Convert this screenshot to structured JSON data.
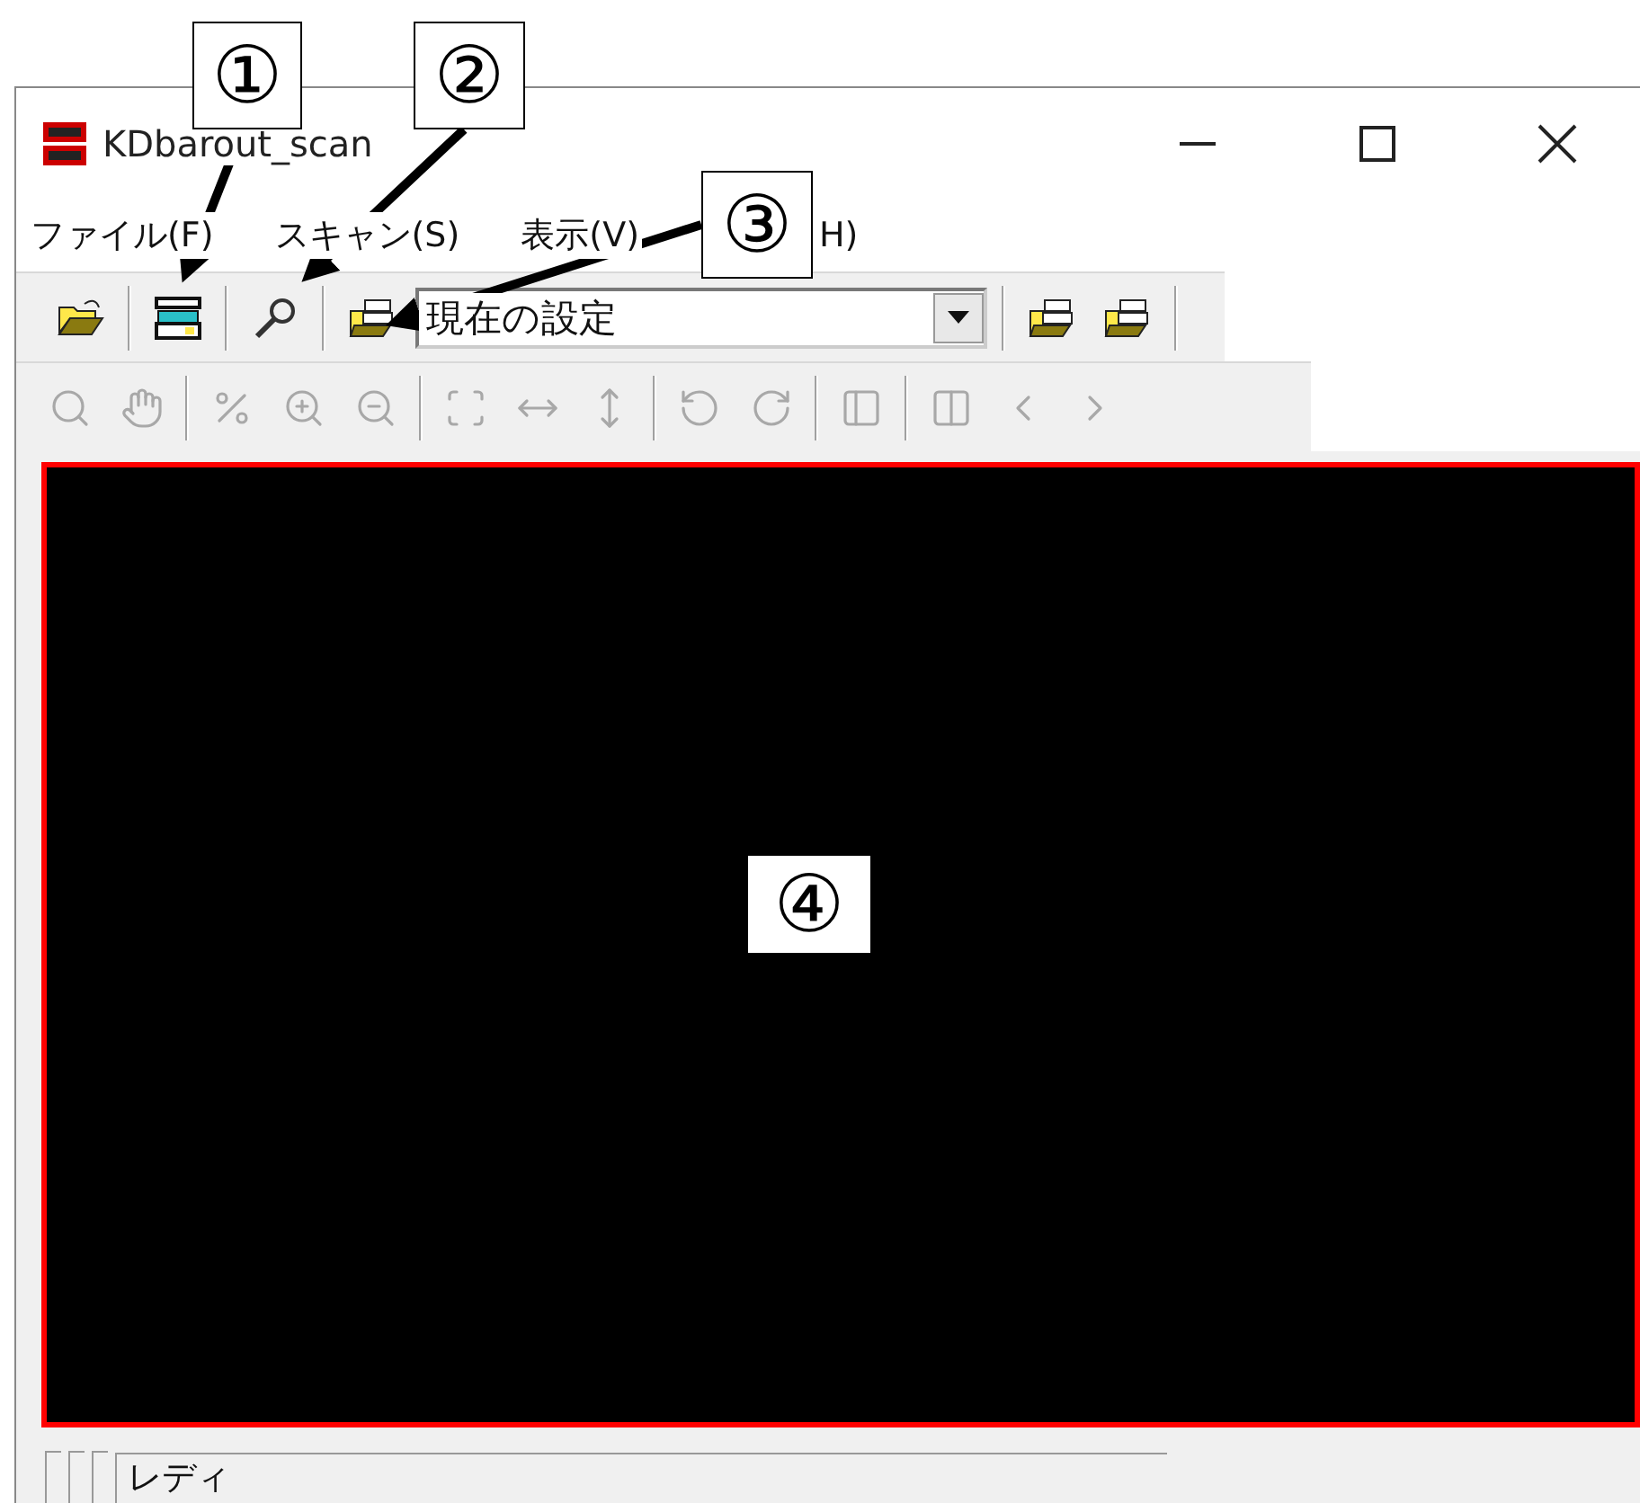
{
  "window": {
    "title": "KDbarout_scan"
  },
  "menu": [
    {
      "label": "ファイル(F)"
    },
    {
      "label": "スキャン(S)"
    },
    {
      "label": "表示(V)"
    },
    {
      "label": "H)"
    }
  ],
  "toolbar": {
    "preset": "現在の設定"
  },
  "view_toolbar": {
    "disabled": true
  },
  "status_bar": {
    "text": "レディ"
  },
  "callouts": [
    {
      "label": "①"
    },
    {
      "label": "②"
    },
    {
      "label": "③"
    },
    {
      "label": "④"
    }
  ]
}
